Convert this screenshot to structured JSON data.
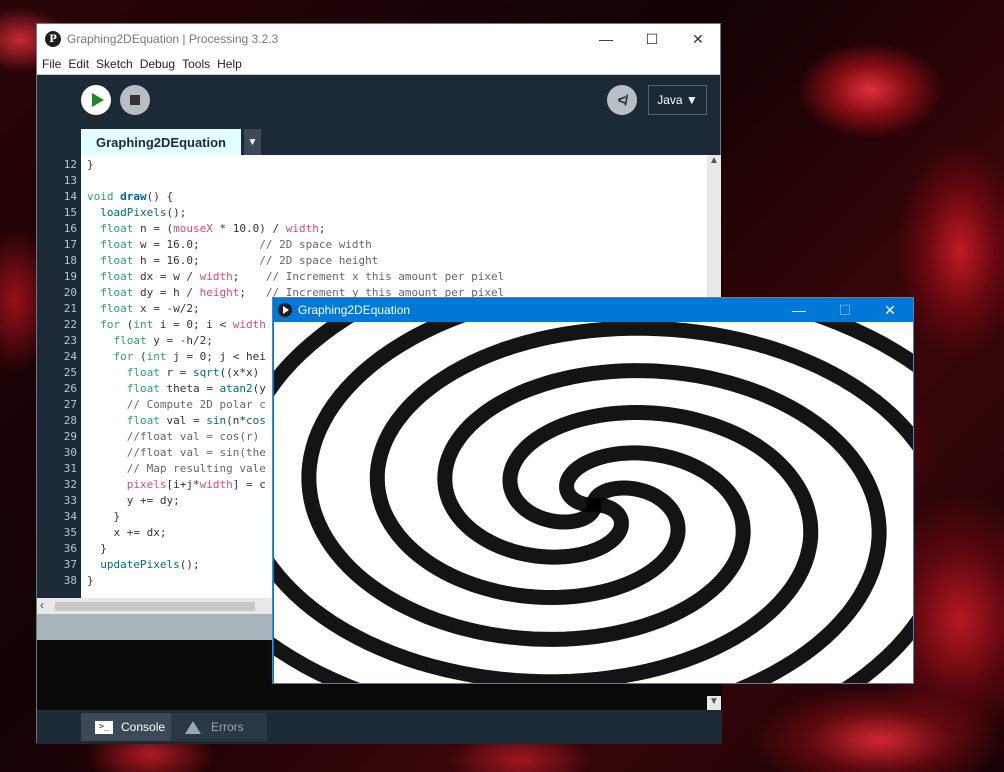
{
  "ide": {
    "title": "Graphing2DEquation | Processing 3.2.3",
    "icon": "processing-logo-icon",
    "menu": [
      "File",
      "Edit",
      "Sketch",
      "Debug",
      "Tools",
      "Help"
    ],
    "mode": "Java ▼",
    "tab": "Graphing2DEquation",
    "footer_tabs": [
      "Console",
      "Errors"
    ]
  },
  "code_lines": [
    {
      "n": "12",
      "t": "}"
    },
    {
      "n": "13",
      "t": ""
    },
    {
      "n": "14",
      "t": "void draw() {"
    },
    {
      "n": "15",
      "t": "  loadPixels();"
    },
    {
      "n": "16",
      "t": "  float n = (mouseX * 10.0) / width;"
    },
    {
      "n": "17",
      "t": "  float w = 16.0;         // 2D space width"
    },
    {
      "n": "18",
      "t": "  float h = 16.0;         // 2D space height"
    },
    {
      "n": "19",
      "t": "  float dx = w / width;    // Increment x this amount per pixel"
    },
    {
      "n": "20",
      "t": "  float dy = h / height;   // Increment y this amount per pixel"
    },
    {
      "n": "21",
      "t": "  float x = -w/2;"
    },
    {
      "n": "22",
      "t": "  for (int i = 0; i < width"
    },
    {
      "n": "23",
      "t": "    float y = -h/2;"
    },
    {
      "n": "24",
      "t": "    for (int j = 0; j < hei"
    },
    {
      "n": "25",
      "t": "      float r = sqrt((x*x)"
    },
    {
      "n": "26",
      "t": "      float theta = atan2(y"
    },
    {
      "n": "27",
      "t": "      // Compute 2D polar c"
    },
    {
      "n": "28",
      "t": "      float val = sin(n*cos"
    },
    {
      "n": "29",
      "t": "      //float val = cos(r)"
    },
    {
      "n": "30",
      "t": "      //float val = sin(the"
    },
    {
      "n": "31",
      "t": "      // Map resulting vale"
    },
    {
      "n": "32",
      "t": "      pixels[i+j*width] = c"
    },
    {
      "n": "33",
      "t": "      y += dy;"
    },
    {
      "n": "34",
      "t": "    }"
    },
    {
      "n": "35",
      "t": "    x += dx;"
    },
    {
      "n": "36",
      "t": "  }"
    },
    {
      "n": "37",
      "t": "  updatePixels();"
    },
    {
      "n": "38",
      "t": "}"
    }
  ],
  "sketch": {
    "title": "Graphing2DEquation"
  }
}
